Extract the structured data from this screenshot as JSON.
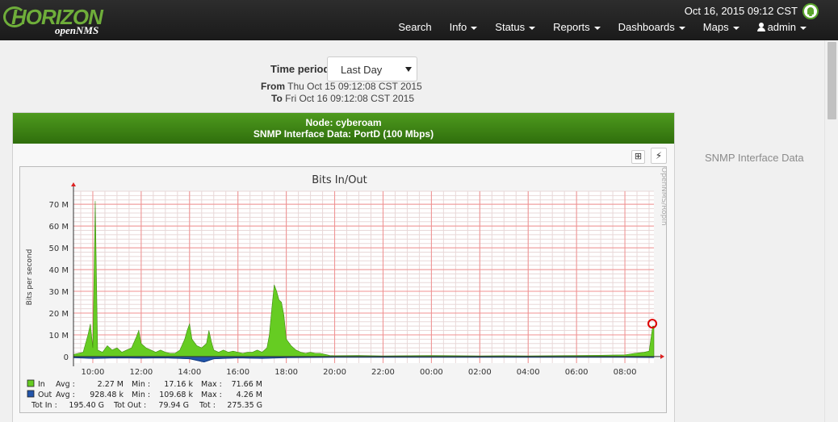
{
  "navbar": {
    "datetime": "Oct 16, 2015 09:12 CST",
    "logo_main": "HORIZON",
    "logo_sub": "openNMS",
    "items": [
      {
        "label": "Search",
        "dropdown": false
      },
      {
        "label": "Info",
        "dropdown": true
      },
      {
        "label": "Status",
        "dropdown": true
      },
      {
        "label": "Reports",
        "dropdown": true
      },
      {
        "label": "Dashboards",
        "dropdown": true
      },
      {
        "label": "Maps",
        "dropdown": true
      },
      {
        "label": "admin",
        "dropdown": true,
        "icon": "user-icon"
      }
    ]
  },
  "time_period": {
    "label": "Time period",
    "selected": "Last Day",
    "from_label": "From",
    "from_value": "Thu Oct 15 09:12:08 CST 2015",
    "to_label": "To",
    "to_value": "Fri Oct 16 09:12:08 CST 2015"
  },
  "panel": {
    "node_title": "Node: cyberoam",
    "subtitle": "SNMP Interface Data: PortD (100 Mbps)"
  },
  "side_label": "SNMP Interface Data",
  "toolbar": {
    "expand_icon": "plus-square-icon",
    "action_icon": "lightning-icon"
  },
  "colors": {
    "in_series": "#66cc22",
    "out_series": "#2255aa",
    "header_green": "#3f8616"
  },
  "chart_data": {
    "type": "area",
    "title": "Bits In/Out",
    "ylabel": "Bits per second",
    "watermark": "OpenNMS/Ropin",
    "ylim": [
      -3,
      76
    ],
    "yticks": [
      {
        "v": 0,
        "label": "0"
      },
      {
        "v": 10,
        "label": "10 M"
      },
      {
        "v": 20,
        "label": "20 M"
      },
      {
        "v": 30,
        "label": "30 M"
      },
      {
        "v": 40,
        "label": "40 M"
      },
      {
        "v": 50,
        "label": "50 M"
      },
      {
        "v": 60,
        "label": "60 M"
      },
      {
        "v": 70,
        "label": "70 M"
      }
    ],
    "xlim": [
      9.2,
      33.2
    ],
    "xticks": [
      {
        "h": 10,
        "label": "10:00"
      },
      {
        "h": 12,
        "label": "12:00"
      },
      {
        "h": 14,
        "label": "14:00"
      },
      {
        "h": 16,
        "label": "16:00"
      },
      {
        "h": 18,
        "label": "18:00"
      },
      {
        "h": 20,
        "label": "20:00"
      },
      {
        "h": 22,
        "label": "22:00"
      },
      {
        "h": 24,
        "label": "00:00"
      },
      {
        "h": 26,
        "label": "02:00"
      },
      {
        "h": 28,
        "label": "04:00"
      },
      {
        "h": 30,
        "label": "06:00"
      },
      {
        "h": 32,
        "label": "08:00"
      }
    ],
    "series": [
      {
        "name": "In",
        "points": [
          [
            9.2,
            1
          ],
          [
            9.4,
            1.5
          ],
          [
            9.6,
            2
          ],
          [
            9.8,
            10
          ],
          [
            9.9,
            15
          ],
          [
            10.0,
            4
          ],
          [
            10.1,
            71.5
          ],
          [
            10.2,
            3
          ],
          [
            10.4,
            2
          ],
          [
            10.6,
            5
          ],
          [
            10.8,
            3
          ],
          [
            11.0,
            4
          ],
          [
            11.2,
            2
          ],
          [
            11.4,
            3
          ],
          [
            11.6,
            4
          ],
          [
            11.8,
            9
          ],
          [
            11.9,
            12
          ],
          [
            12.0,
            6
          ],
          [
            12.2,
            4
          ],
          [
            12.4,
            3
          ],
          [
            12.6,
            2
          ],
          [
            12.8,
            3
          ],
          [
            13.0,
            2
          ],
          [
            13.2,
            1.5
          ],
          [
            13.4,
            1.5
          ],
          [
            13.6,
            3
          ],
          [
            13.8,
            8
          ],
          [
            13.9,
            12
          ],
          [
            14.0,
            15
          ],
          [
            14.1,
            8
          ],
          [
            14.3,
            5
          ],
          [
            14.5,
            4
          ],
          [
            14.7,
            6
          ],
          [
            14.8,
            12
          ],
          [
            14.9,
            7
          ],
          [
            15.0,
            3
          ],
          [
            15.2,
            2
          ],
          [
            15.4,
            3
          ],
          [
            15.6,
            2
          ],
          [
            15.8,
            2.5
          ],
          [
            16.0,
            2
          ],
          [
            16.2,
            1.5
          ],
          [
            16.4,
            2
          ],
          [
            16.6,
            2
          ],
          [
            16.8,
            3
          ],
          [
            17.0,
            2
          ],
          [
            17.2,
            4
          ],
          [
            17.3,
            10
          ],
          [
            17.4,
            22
          ],
          [
            17.5,
            33
          ],
          [
            17.6,
            30
          ],
          [
            17.7,
            26
          ],
          [
            17.8,
            25
          ],
          [
            17.9,
            19
          ],
          [
            18.0,
            8
          ],
          [
            18.2,
            5
          ],
          [
            18.4,
            3
          ],
          [
            18.6,
            2
          ],
          [
            18.8,
            1.5
          ],
          [
            19.0,
            2
          ],
          [
            19.2,
            1.5
          ],
          [
            19.4,
            1.5
          ],
          [
            19.6,
            1
          ],
          [
            19.8,
            0.5
          ],
          [
            20.0,
            0.4
          ],
          [
            21.0,
            0.5
          ],
          [
            22.0,
            0.3
          ],
          [
            23.0,
            0.4
          ],
          [
            24.0,
            0.5
          ],
          [
            25.0,
            0.4
          ],
          [
            26.0,
            0.3
          ],
          [
            27.0,
            0.4
          ],
          [
            28.0,
            0.3
          ],
          [
            29.0,
            0.4
          ],
          [
            30.0,
            0.5
          ],
          [
            31.0,
            0.6
          ],
          [
            32.0,
            0.8
          ],
          [
            32.4,
            1.5
          ],
          [
            32.8,
            2
          ],
          [
            33.0,
            2.5
          ],
          [
            33.15,
            14
          ],
          [
            33.2,
            14
          ]
        ]
      },
      {
        "name": "Out",
        "points": [
          [
            9.2,
            -0.5
          ],
          [
            10,
            -0.8
          ],
          [
            11,
            -0.6
          ],
          [
            12,
            -0.7
          ],
          [
            13,
            -0.6
          ],
          [
            14,
            -1
          ],
          [
            14.6,
            -2.5
          ],
          [
            15,
            -1
          ],
          [
            16,
            -0.6
          ],
          [
            17,
            -0.8
          ],
          [
            18,
            -0.5
          ],
          [
            19,
            -0.4
          ],
          [
            20,
            -0.3
          ],
          [
            22,
            -0.3
          ],
          [
            24,
            -0.3
          ],
          [
            26,
            -0.3
          ],
          [
            28,
            -0.3
          ],
          [
            30,
            -0.3
          ],
          [
            32,
            -0.3
          ],
          [
            33.2,
            -0.4
          ]
        ]
      }
    ],
    "legend": [
      {
        "series": "In",
        "avg_label": "Avg :",
        "avg": "2.27 M",
        "min_label": "Min :",
        "min": "17.16 k",
        "max_label": "Max :",
        "max": "71.66 M"
      },
      {
        "series": "Out",
        "avg_label": "Avg :",
        "avg": "928.48 k",
        "min_label": "Min :",
        "min": "109.68 k",
        "max_label": "Max :",
        "max": "4.26 M"
      }
    ],
    "totals": {
      "tot_in_label": "Tot In :",
      "tot_in": "195.40 G",
      "tot_out_label": "Tot Out :",
      "tot_out": "79.94 G",
      "tot_label": "Tot :",
      "tot": "275.35 G"
    }
  }
}
